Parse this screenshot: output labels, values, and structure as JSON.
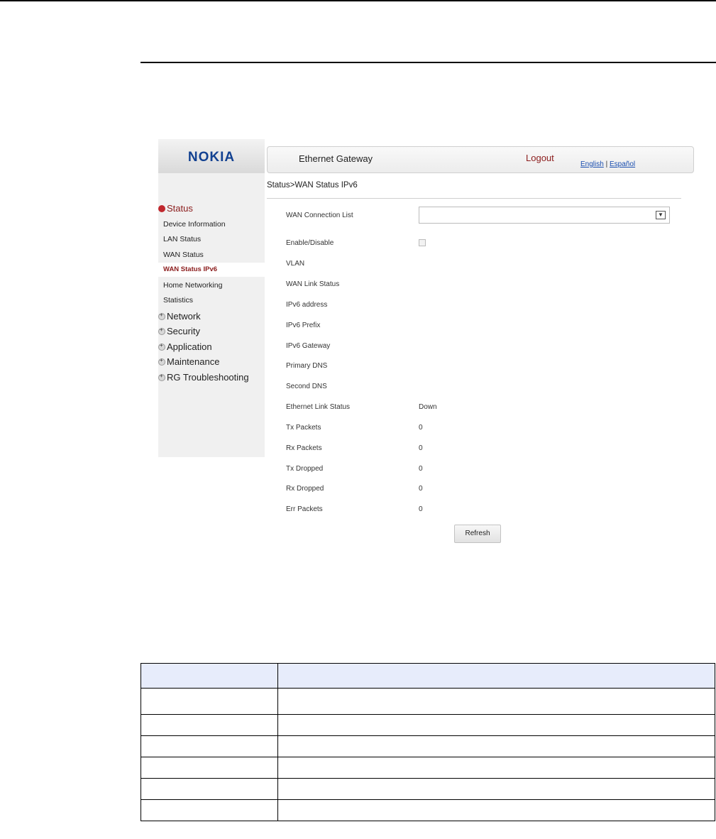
{
  "brand": {
    "logo": "NOKIA",
    "color": "#124191"
  },
  "header": {
    "title": "Ethernet Gateway",
    "logout": "Logout",
    "lang_english": "English",
    "lang_sep": "|",
    "lang_spanish": "Español"
  },
  "breadcrumb": "Status>WAN Status IPv6",
  "sidebar": {
    "status_group": "Status",
    "status_items": [
      "Device Information",
      "LAN Status",
      "WAN Status",
      "WAN Status IPv6",
      "Home Networking",
      "Statistics"
    ],
    "active_item": "WAN Status IPv6",
    "groups": [
      "Network",
      "Security",
      "Application",
      "Maintenance",
      "RG Troubleshooting"
    ]
  },
  "fields": {
    "wan_connection_list": {
      "label": "WAN Connection List",
      "value": ""
    },
    "enable_disable": {
      "label": "Enable/Disable"
    },
    "vlan": {
      "label": "VLAN",
      "value": ""
    },
    "wan_link_status": {
      "label": "WAN Link Status",
      "value": ""
    },
    "ipv6_address": {
      "label": "IPv6 address",
      "value": ""
    },
    "ipv6_prefix": {
      "label": "IPv6 Prefix",
      "value": ""
    },
    "ipv6_gateway": {
      "label": "IPv6 Gateway",
      "value": ""
    },
    "primary_dns": {
      "label": "Primary DNS",
      "value": ""
    },
    "second_dns": {
      "label": "Second DNS",
      "value": ""
    },
    "ethernet_link_status": {
      "label": "Ethernet Link Status",
      "value": "Down"
    },
    "tx_packets": {
      "label": "Tx Packets",
      "value": "0"
    },
    "rx_packets": {
      "label": "Rx Packets",
      "value": "0"
    },
    "tx_dropped": {
      "label": "Tx Dropped",
      "value": "0"
    },
    "rx_dropped": {
      "label": "Rx Dropped",
      "value": "0"
    },
    "err_packets": {
      "label": "Err Packets",
      "value": "0"
    }
  },
  "refresh_label": "Refresh",
  "colors": {
    "accent_red": "#8b1c1c",
    "table_header": "#e7ecfb",
    "sidebar_bg": "#f0f0f0"
  }
}
